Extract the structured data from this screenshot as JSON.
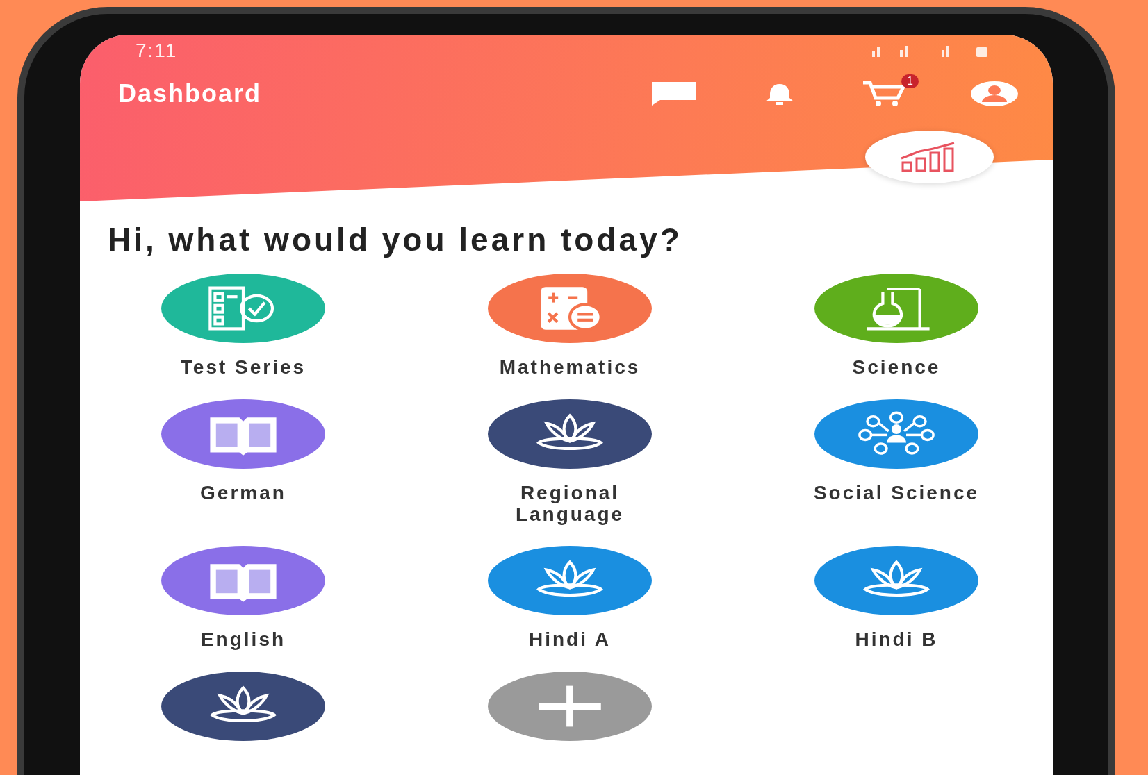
{
  "status_bar": {
    "time": "7:11"
  },
  "app_bar": {
    "title": "Dashboard",
    "cart_badge": "1"
  },
  "greeting": "Hi, what would you learn today?",
  "subjects": [
    {
      "label": "Test Series",
      "kind": "checklist",
      "color": "#1fb89a"
    },
    {
      "label": "Mathematics",
      "kind": "calculator",
      "color": "#f5734c"
    },
    {
      "label": "Science",
      "kind": "flask",
      "color": "#5fae1c"
    },
    {
      "label": "German",
      "kind": "book",
      "color": "#8a6fe8"
    },
    {
      "label": "Regional Language",
      "kind": "lotus",
      "color": "#3a4a78"
    },
    {
      "label": "Social Science",
      "kind": "network",
      "color": "#1a8fe0"
    },
    {
      "label": "English",
      "kind": "book",
      "color": "#8a6fe8"
    },
    {
      "label": "Hindi A",
      "kind": "lotus",
      "color": "#1a8fe0"
    },
    {
      "label": "Hindi B",
      "kind": "lotus",
      "color": "#1a8fe0"
    },
    {
      "kind": "lotus",
      "color": "#3a4a78"
    },
    {
      "kind": "plus",
      "color": "#9a9a9a"
    }
  ]
}
